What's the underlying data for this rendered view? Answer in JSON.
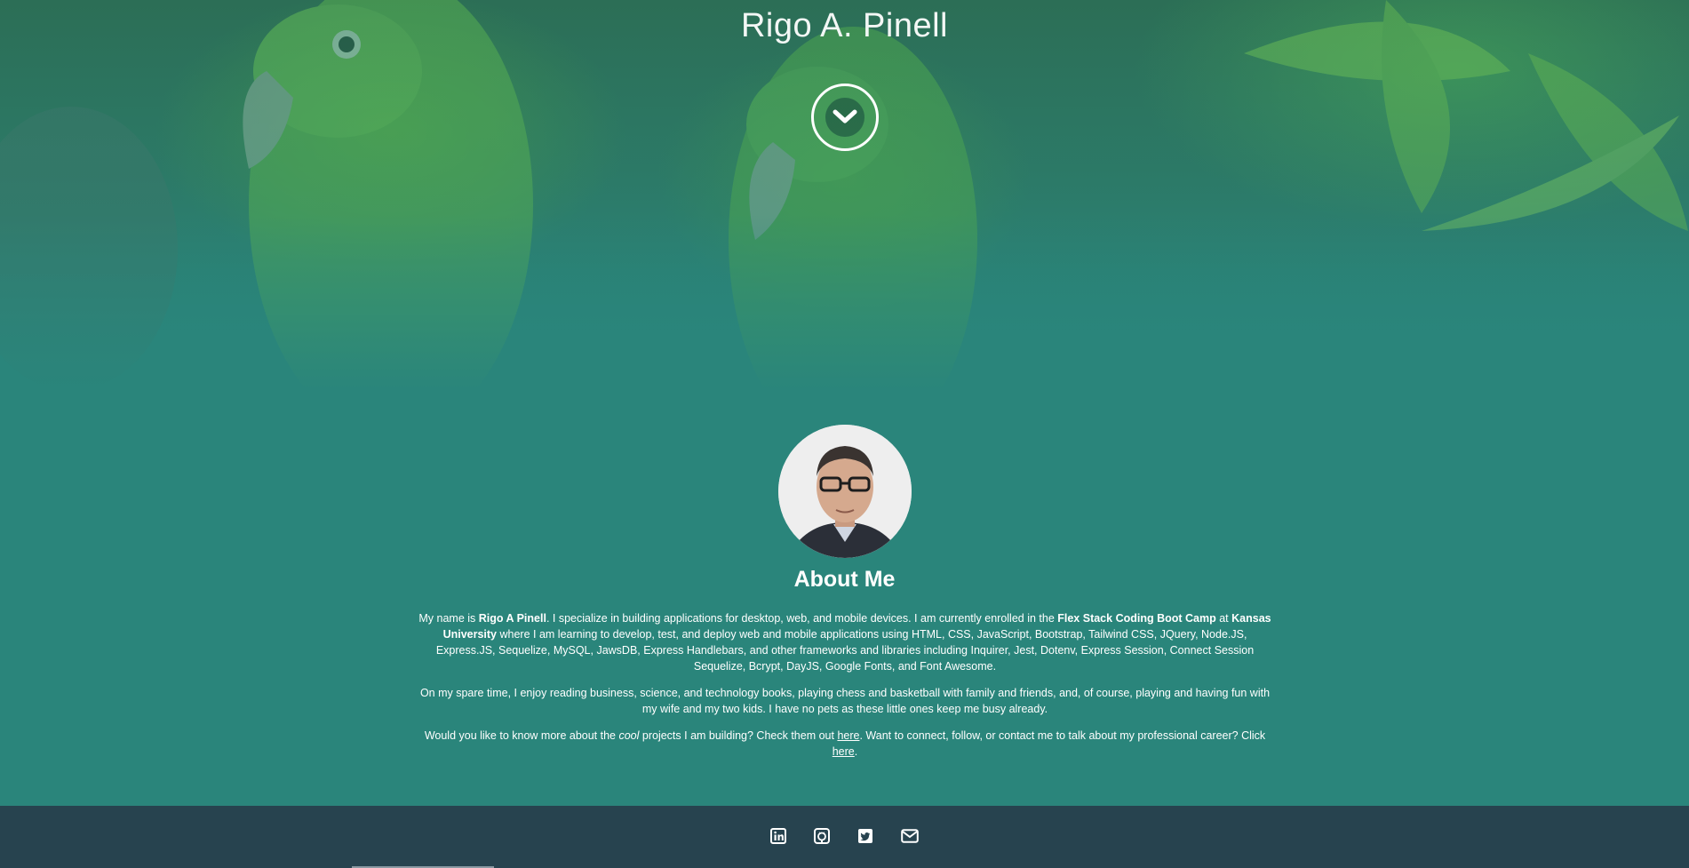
{
  "header": {
    "site_title": "Rigo A. Pinell",
    "scroll_button_icon": "chevron-down-icon"
  },
  "about": {
    "heading": "About Me",
    "avatar_icon": "profile-photo",
    "p1": {
      "t1": "My name is ",
      "name": "Rigo A Pinell",
      "t2": ". I specialize in building applications for desktop, web, and mobile devices. I am currently enrolled in the ",
      "bootcamp": "Flex Stack Coding Boot Camp",
      "t3": " at ",
      "university": "Kansas University",
      "t4": " where I am learning to develop, test, and deploy web and mobile applications using HTML, CSS, JavaScript, Bootstrap, Tailwind CSS, JQuery, Node.JS, Express.JS, Sequelize, MySQL, JawsDB, Express Handlebars, and other frameworks and libraries including Inquirer, Jest, Dotenv, Express Session, Connect Session Sequelize, Bcrypt, DayJS, Google Fonts, and Font Awesome."
    },
    "p2": "On my spare time, I enjoy reading business, science, and technology books, playing chess and basketball with family and friends, and, of course, playing and having fun with my wife and my two kids. I have no pets as these little ones keep me busy already.",
    "p3": {
      "t1": "Would you like to know more about the ",
      "cool": "cool",
      "t2": " projects I am building? Check them out ",
      "link1": "here",
      "t3": ". Want to connect, follow, or contact me to talk about my professional career? Click ",
      "link2": "here",
      "t4": "."
    }
  },
  "footer": {
    "social": [
      {
        "name": "LinkedIn",
        "icon": "linkedin-icon"
      },
      {
        "name": "GitHub",
        "icon": "github-icon"
      },
      {
        "name": "Twitter",
        "icon": "twitter-icon"
      },
      {
        "name": "Email",
        "icon": "envelope-icon"
      }
    ]
  },
  "colors": {
    "teal_background": "#2a857b",
    "footer_background": "#27434f",
    "text": "#ffffff"
  }
}
